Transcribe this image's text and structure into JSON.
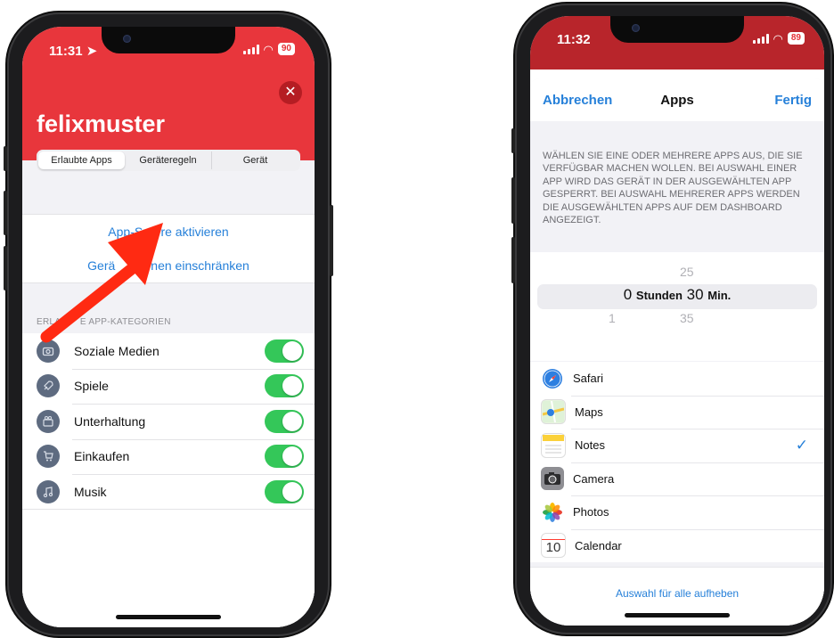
{
  "left_phone": {
    "status": {
      "time": "11:31",
      "battery": "90"
    },
    "username": "felixmuster",
    "segments": [
      "Erlaubte Apps",
      "Geräteregeln",
      "Gerät"
    ],
    "actions": {
      "lock": "App-Sperre aktivieren",
      "restrict_prefix": "Gerä",
      "restrict_suffix": "nen einschränken"
    },
    "section_prefix": "ERLAU",
    "section_suffix": "E APP-KATEGORIEN",
    "categories": [
      {
        "label": "Soziale Medien",
        "icon": "camera-icon",
        "enabled": true
      },
      {
        "label": "Spiele",
        "icon": "rocket-icon",
        "enabled": true
      },
      {
        "label": "Unterhaltung",
        "icon": "video-icon",
        "enabled": true
      },
      {
        "label": "Einkaufen",
        "icon": "cart-icon",
        "enabled": true
      },
      {
        "label": "Musik",
        "icon": "music-note-icon",
        "enabled": true
      }
    ],
    "accent_color": "#e8363c"
  },
  "right_phone": {
    "status": {
      "time": "11:32",
      "battery": "89"
    },
    "nav": {
      "cancel": "Abbrechen",
      "title": "Apps",
      "done": "Fertig"
    },
    "description": "WÄHLEN SIE EINE ODER MEHRERE APPS AUS, DIE SIE VERFÜGBAR MACHEN WOLLEN. BEI AUSWAHL EINER APP WIRD DAS GERÄT IN DER AUSGEWÄHLTEN APP GESPERRT. BEI AUSWAHL MEHRERER APPS WERDEN DIE AUSGEWÄHLTEN APPS AUF DEM DASHBOARD ANGEZEIGT.",
    "picker": {
      "minutes_above": "25",
      "hours": "0",
      "hours_unit": "Stunden",
      "minutes": "30",
      "minutes_unit": "Min.",
      "hours_below": "1",
      "minutes_below": "35"
    },
    "apps": [
      {
        "label": "Safari",
        "icon": "safari-icon",
        "checked": false
      },
      {
        "label": "Maps",
        "icon": "maps-icon",
        "checked": false
      },
      {
        "label": "Notes",
        "icon": "notes-icon",
        "checked": true
      },
      {
        "label": "Camera",
        "icon": "camera-icon",
        "checked": false
      },
      {
        "label": "Photos",
        "icon": "photos-icon",
        "checked": false
      },
      {
        "label": "Calendar",
        "icon": "calendar-icon",
        "checked": false,
        "icon_text": "10"
      }
    ],
    "deselect_all": "Auswahl für alle aufheben",
    "link_color": "#2680d9"
  }
}
